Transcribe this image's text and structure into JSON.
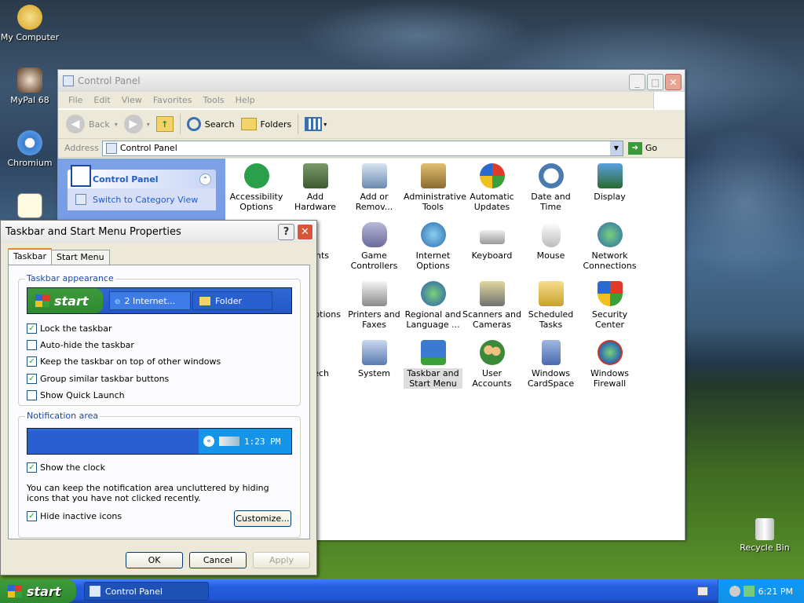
{
  "desktop": {
    "icons": [
      {
        "label": "My Computer",
        "icon": "my-computer-icon"
      },
      {
        "label": "MyPal 68",
        "icon": "mypal-icon"
      },
      {
        "label": "Chromium",
        "icon": "chromium-icon"
      },
      {
        "label": "Recycle Bin",
        "icon": "recycle-bin-icon"
      }
    ]
  },
  "window": {
    "title": "Control Panel",
    "menu": [
      "File",
      "Edit",
      "View",
      "Favorites",
      "Tools",
      "Help"
    ],
    "toolbar": {
      "back": "Back",
      "search": "Search",
      "folders": "Folders"
    },
    "address": {
      "label": "Address",
      "value": "Control Panel",
      "go": "Go"
    },
    "sidebar": {
      "title": "Control Panel",
      "link": "Switch to Category View"
    },
    "items": [
      {
        "label": "Accessibility Options"
      },
      {
        "label": "Add Hardware"
      },
      {
        "label": "Add or Remov..."
      },
      {
        "label": "Administrative Tools"
      },
      {
        "label": "Automatic Updates"
      },
      {
        "label": "Date and Time"
      },
      {
        "label": "Display"
      },
      {
        "label": "nts"
      },
      {
        "label": "Game Controllers"
      },
      {
        "label": "Internet Options"
      },
      {
        "label": "Keyboard"
      },
      {
        "label": "Mouse"
      },
      {
        "label": "Network Connections"
      },
      {
        "label": "ptions"
      },
      {
        "label": "Printers and Faxes"
      },
      {
        "label": "Regional and Language ..."
      },
      {
        "label": "Scanners and Cameras"
      },
      {
        "label": "Scheduled Tasks"
      },
      {
        "label": "Security Center"
      },
      {
        "label": "ech"
      },
      {
        "label": "System"
      },
      {
        "label": "Taskbar and Start Menu"
      },
      {
        "label": "User Accounts"
      },
      {
        "label": "Windows CardSpace"
      },
      {
        "label": "Windows Firewall"
      }
    ]
  },
  "dialog": {
    "title": "Taskbar and Start Menu Properties",
    "help": "?",
    "tabs": [
      "Taskbar",
      "Start Menu"
    ],
    "appearance": {
      "legend": "Taskbar appearance",
      "preview": {
        "start": "start",
        "ie": "2 Internet...",
        "folder": "Folder"
      },
      "options": [
        {
          "label": "Lock the taskbar",
          "checked": true
        },
        {
          "label": "Auto-hide the taskbar",
          "checked": false
        },
        {
          "label": "Keep the taskbar on top of other windows",
          "checked": true
        },
        {
          "label": "Group similar taskbar buttons",
          "checked": true
        },
        {
          "label": "Show Quick Launch",
          "checked": false
        }
      ]
    },
    "notification": {
      "legend": "Notification area",
      "clock": "1:23 PM",
      "show_clock": "Show the clock",
      "description": "You can keep the notification area uncluttered by hiding icons that you have not clicked recently.",
      "hide_inactive": "Hide inactive icons",
      "customize": "Customize..."
    },
    "buttons": {
      "ok": "OK",
      "cancel": "Cancel",
      "apply": "Apply"
    }
  },
  "taskbar": {
    "start": "start",
    "item": "Control Panel",
    "clock": "6:21 PM"
  }
}
